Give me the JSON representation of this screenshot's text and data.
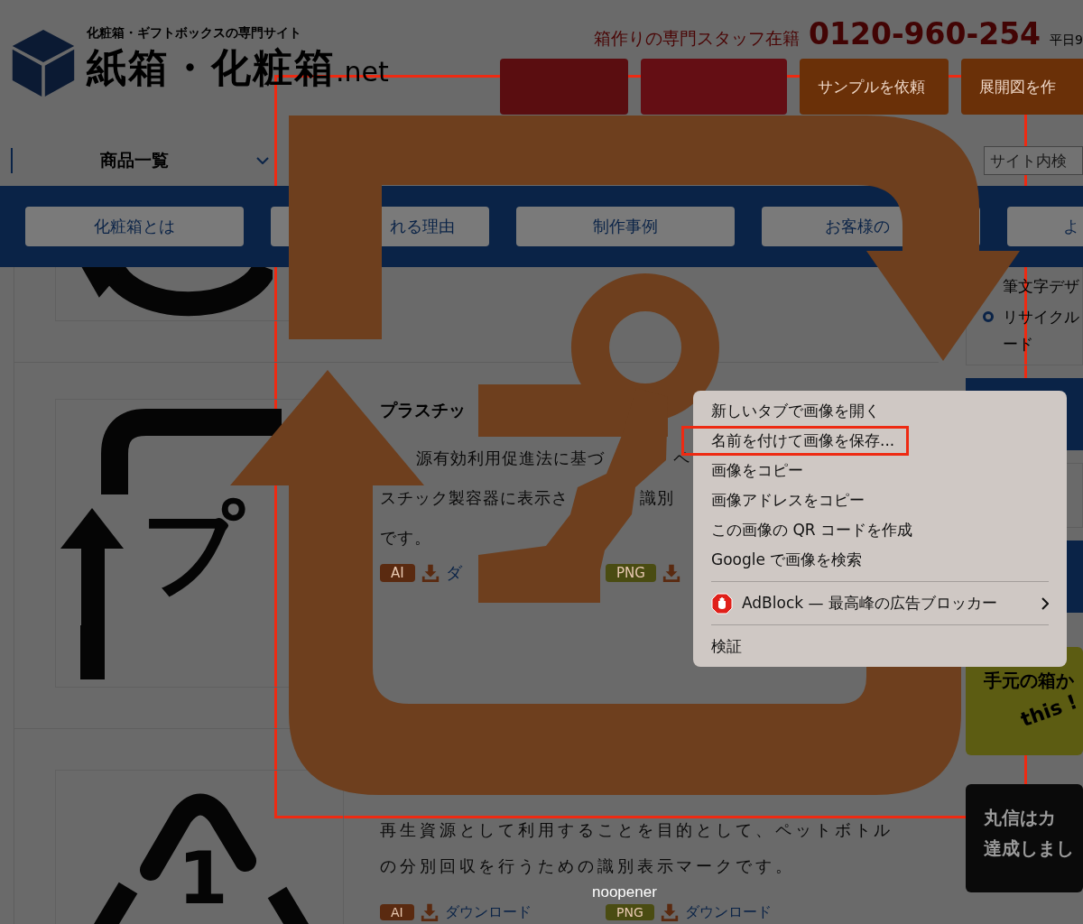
{
  "header": {
    "tagline": "化粧箱・ギフトボックスの専門サイト",
    "logo": "紙箱・化粧箱",
    "logo_suffix": ".net",
    "staff_note": "箱作りの専門スタッフ在籍",
    "phone": "0120-960-254",
    "hours": "平日9",
    "buttons": [
      {
        "kind": "contact"
      },
      {
        "kind": "quote"
      },
      {
        "kind": "sample",
        "label": "サンプルを依頼"
      },
      {
        "kind": "diagram",
        "label": "展開図を作"
      }
    ]
  },
  "nav": {
    "products": "商品一覧",
    "search_placeholder": "サイト内検"
  },
  "menu_bar": [
    "化粧箱とは",
    "れる理由",
    "制作事例",
    "お客様の",
    "よ"
  ],
  "products": [
    {
      "kind": "circle"
    },
    {
      "kind": "pla",
      "mark_text": "プ",
      "title": "プラスチッ",
      "lines": [
        [
          "源有効利用促進法に基づ",
          "ペ"
        ],
        [
          "スチック製容器に表示さ",
          "識別"
        ],
        [
          "です。"
        ]
      ],
      "downloads": [
        {
          "format": "AI",
          "color": "#5a2a10",
          "link": "ダ"
        },
        {
          "format": "PNG",
          "color": "#4a4c12"
        }
      ]
    },
    {
      "kind": "pet",
      "mark_text": "1",
      "text": "再生資源として利用することを目的として、ペットボトルの分別回収を行うための識別表示マークです。",
      "downloads": [
        {
          "format": "AI",
          "color": "#5a2a10",
          "link": "ダウンロード"
        },
        {
          "format": "PNG",
          "color": "#4a4c12",
          "link": "ダウンロード"
        }
      ]
    }
  ],
  "sidebar": {
    "links": [
      {
        "lines": [
          "筆文字デザ"
        ]
      },
      {
        "lines": [
          "リサイクル",
          "ード"
        ],
        "bullet": true
      }
    ],
    "tiles": [
      {
        "kind": "blue"
      },
      {
        "kind": "plain"
      },
      {
        "kind": "blue"
      }
    ],
    "banners": [
      {
        "kind": "yellow",
        "lines": [
          "手元の箱か"
        ],
        "accent": "this !"
      },
      {
        "kind": "dark",
        "lines": [
          "丸信はカ",
          "達成しまし"
        ]
      }
    ]
  },
  "context_menu": {
    "groups": [
      [
        {
          "kind": "command",
          "label": "新しいタブで画像を開く",
          "marked": false
        },
        {
          "kind": "command",
          "label": "名前を付けて画像を保存...",
          "marked": true
        },
        {
          "kind": "command",
          "label": "画像をコピー",
          "marked": false
        },
        {
          "kind": "command",
          "label": "画像アドレスをコピー",
          "marked": false
        },
        {
          "kind": "command",
          "label": "この画像の QR コードを作成",
          "marked": false
        },
        {
          "kind": "command",
          "label": "Google で画像を検索",
          "marked": false
        }
      ],
      [
        {
          "kind": "extension",
          "label": "AdBlock — 最高峰の広告ブロッカー",
          "marked": false,
          "submenu": true
        }
      ],
      [
        {
          "kind": "command",
          "label": "検証",
          "marked": false
        }
      ]
    ]
  },
  "caption": "noopener"
}
